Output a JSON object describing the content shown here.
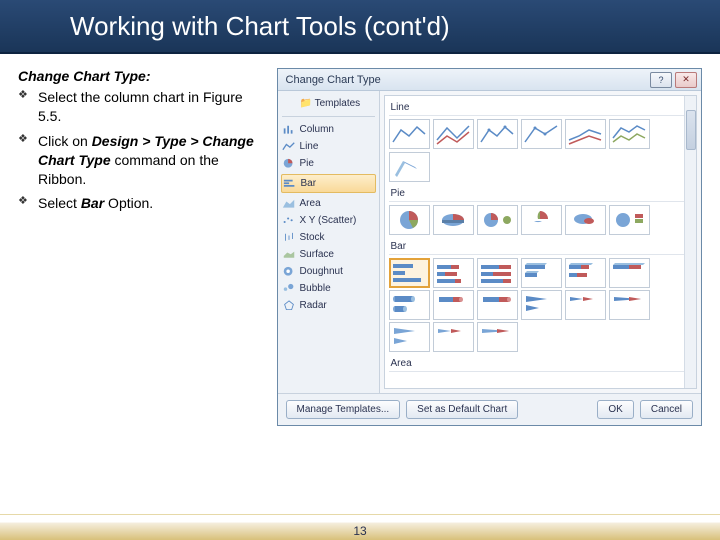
{
  "slide": {
    "title": "Working with Chart Tools (cont'd)",
    "heading": "Change Chart Type:",
    "bullets": [
      {
        "pre": "Select the column chart in Figure 5.5.",
        "bold1": "",
        "mid": "",
        "bold2": "",
        "post": ""
      },
      {
        "pre": "Click on ",
        "bold1": "Design > Type > Change Chart Type",
        "mid": " command on the Ribbon.",
        "bold2": "",
        "post": ""
      },
      {
        "pre": "Select ",
        "bold1": "Bar",
        "mid": " Option.",
        "bold2": "",
        "post": ""
      }
    ],
    "page_number": "13"
  },
  "dialog": {
    "title": "Change Chart Type",
    "help_label": "?",
    "close_label": "✕",
    "templates_label": "Templates",
    "categories": [
      "Column",
      "Line",
      "Pie",
      "Bar",
      "Area",
      "X Y (Scatter)",
      "Stock",
      "Surface",
      "Doughnut",
      "Bubble",
      "Radar"
    ],
    "selected_category": "Bar",
    "gallery_sections": [
      "Line",
      "Pie",
      "Bar",
      "Area"
    ],
    "footer": {
      "manage": "Manage Templates...",
      "set_default": "Set as Default Chart",
      "ok": "OK",
      "cancel": "Cancel"
    }
  }
}
